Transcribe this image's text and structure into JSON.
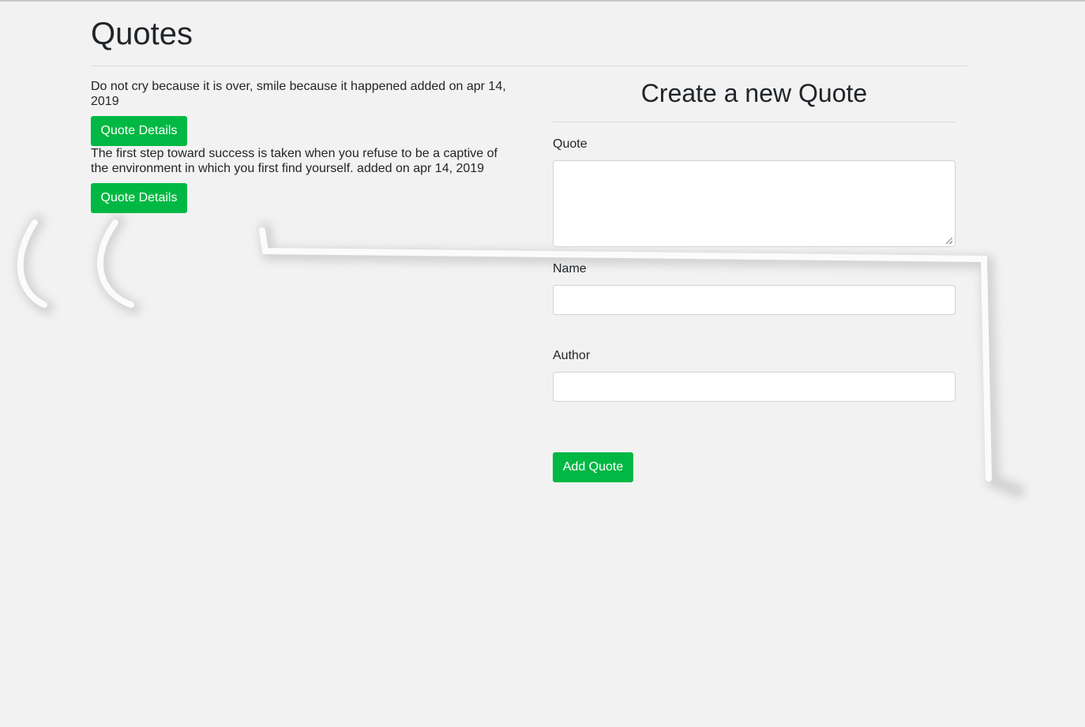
{
  "header": {
    "title": "Quotes"
  },
  "quotes": [
    {
      "text": "Do not cry because it is over, smile because it happened added on apr 14, 2019",
      "button_label": "Quote Details"
    },
    {
      "text": "The first step toward success is taken when you refuse to be a captive of the environment in which you first find yourself. added on apr 14, 2019",
      "button_label": "Quote Details"
    }
  ],
  "form": {
    "title": "Create a new Quote",
    "quote_label": "Quote",
    "quote_value": "",
    "name_label": "Name",
    "name_value": "",
    "author_label": "Author",
    "author_value": "",
    "submit_label": "Add Quote"
  },
  "colors": {
    "accent": "#00b843",
    "background": "#f2f2f2",
    "text": "#212529"
  },
  "icons": {
    "background": "quote-mark-icon"
  }
}
